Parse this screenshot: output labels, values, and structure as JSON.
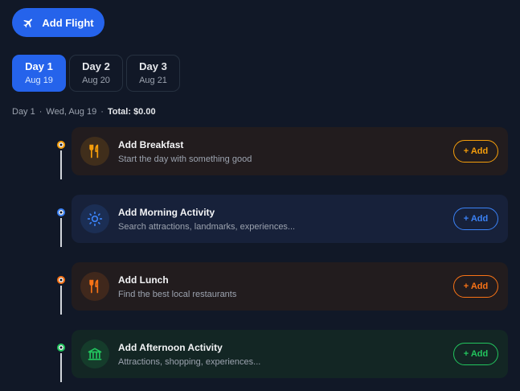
{
  "header": {
    "add_flight_label": "Add Flight"
  },
  "days": [
    {
      "label": "Day 1",
      "date": "Aug 19",
      "active": true
    },
    {
      "label": "Day 2",
      "date": "Aug 20",
      "active": false
    },
    {
      "label": "Day 3",
      "date": "Aug 21",
      "active": false
    }
  ],
  "summary": {
    "day": "Day 1",
    "sep1": "·",
    "date": "Wed, Aug 19",
    "sep2": "·",
    "total": "Total: $0.00"
  },
  "items": [
    {
      "title": "Add Breakfast",
      "subtitle": "Start the day with something good",
      "button": "+ Add",
      "icon": "utensils-icon",
      "color": "#f59e0b",
      "card_bg": "#221c1e"
    },
    {
      "title": "Add Morning Activity",
      "subtitle": "Search attractions, landmarks, experiences...",
      "button": "+ Add",
      "icon": "sun-icon",
      "color": "#3b82f6",
      "card_bg": "#17213a"
    },
    {
      "title": "Add Lunch",
      "subtitle": "Find the best local restaurants",
      "button": "+ Add",
      "icon": "utensils-icon",
      "color": "#f97316",
      "card_bg": "#221c1e"
    },
    {
      "title": "Add Afternoon Activity",
      "subtitle": "Attractions, shopping, experiences...",
      "button": "+ Add",
      "icon": "museum-icon",
      "color": "#22c55e",
      "card_bg": "#132624"
    }
  ]
}
